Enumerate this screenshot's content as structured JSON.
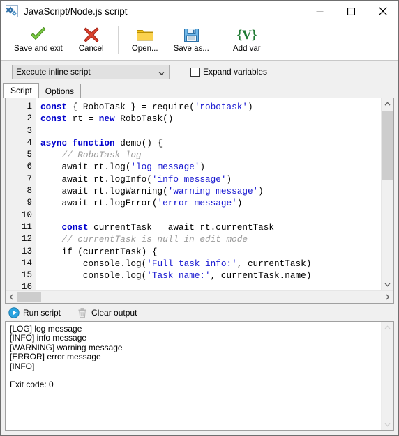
{
  "window": {
    "title": "JavaScript/Node.js script",
    "icon": "gears-icon",
    "minimize_label": "—",
    "maximize_label": "□",
    "close_label": "✕"
  },
  "toolbar": {
    "items": [
      {
        "label": "Save and exit",
        "icon": "green-check-icon"
      },
      {
        "label": "Cancel",
        "icon": "red-x-icon"
      },
      {
        "label": "Open...",
        "icon": "folder-icon"
      },
      {
        "label": "Save as...",
        "icon": "floppy-disk-icon"
      },
      {
        "label": "Add var",
        "icon": "variable-braces-icon"
      }
    ]
  },
  "options": {
    "mode_select_value": "Execute inline script",
    "expand_variables_label": "Expand variables",
    "expand_variables_checked": false
  },
  "tabs": [
    {
      "label": "Script",
      "active": true
    },
    {
      "label": "Options",
      "active": false
    }
  ],
  "editor": {
    "line_numbers": [
      "1",
      "2",
      "3",
      "4",
      "5",
      "6",
      "7",
      "8",
      "9",
      "10",
      "11",
      "12",
      "13",
      "14",
      "15",
      "16"
    ],
    "lines": [
      [
        {
          "t": "const",
          "c": "kw"
        },
        {
          "t": " { RoboTask } = require(",
          "c": ""
        },
        {
          "t": "'robotask'",
          "c": "str"
        },
        {
          "t": ")",
          "c": ""
        }
      ],
      [
        {
          "t": "const",
          "c": "kw"
        },
        {
          "t": " rt = ",
          "c": ""
        },
        {
          "t": "new",
          "c": "kw"
        },
        {
          "t": " RoboTask()",
          "c": ""
        }
      ],
      [],
      [
        {
          "t": "async",
          "c": "kw"
        },
        {
          "t": " ",
          "c": ""
        },
        {
          "t": "function",
          "c": "kw"
        },
        {
          "t": " demo() {",
          "c": ""
        }
      ],
      [
        {
          "t": "    // RoboTask log",
          "c": "cmt"
        }
      ],
      [
        {
          "t": "    await rt.log(",
          "c": ""
        },
        {
          "t": "'log message'",
          "c": "str"
        },
        {
          "t": ")",
          "c": ""
        }
      ],
      [
        {
          "t": "    await rt.logInfo(",
          "c": ""
        },
        {
          "t": "'info message'",
          "c": "str"
        },
        {
          "t": ")",
          "c": ""
        }
      ],
      [
        {
          "t": "    await rt.logWarning(",
          "c": ""
        },
        {
          "t": "'warning message'",
          "c": "str"
        },
        {
          "t": ")",
          "c": ""
        }
      ],
      [
        {
          "t": "    await rt.logError(",
          "c": ""
        },
        {
          "t": "'error message'",
          "c": "str"
        },
        {
          "t": ")",
          "c": ""
        }
      ],
      [],
      [
        {
          "t": "    ",
          "c": ""
        },
        {
          "t": "const",
          "c": "kw"
        },
        {
          "t": " currentTask = await rt.currentTask",
          "c": ""
        }
      ],
      [
        {
          "t": "    // currentTask is null in edit mode",
          "c": "cmt"
        }
      ],
      [
        {
          "t": "    if (currentTask) {",
          "c": ""
        }
      ],
      [
        {
          "t": "        console.log(",
          "c": ""
        },
        {
          "t": "'Full task info:'",
          "c": "str"
        },
        {
          "t": ", currentTask)",
          "c": ""
        }
      ],
      [
        {
          "t": "        console.log(",
          "c": ""
        },
        {
          "t": "'Task name:'",
          "c": "str"
        },
        {
          "t": ", currentTask.name)",
          "c": ""
        }
      ],
      []
    ]
  },
  "runbar": {
    "run_label": "Run script",
    "run_icon": "play-icon",
    "clear_label": "Clear output",
    "clear_icon": "trash-icon"
  },
  "output": {
    "text": "[LOG] log message\n[INFO] info message\n[WARNING] warning message\n[ERROR] error message\n[INFO]\n\nExit code: 0"
  },
  "colors": {
    "keyword": "#0000cd",
    "string": "#1515d0",
    "comment": "#9b9b9b",
    "accent_green": "#6cbf3a",
    "accent_red": "#d04030",
    "accent_blue": "#3a8fd0",
    "folder_yellow": "#f2c016"
  }
}
